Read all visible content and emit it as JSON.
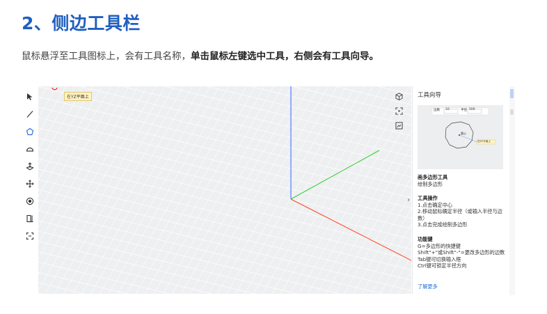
{
  "heading": "2、侧边工具栏",
  "description": {
    "normal": "鼠标悬浮至工具图标上，会有工具名称，",
    "bold": "单击鼠标左键选中工具，右侧会有工具向导。"
  },
  "viewport": {
    "tooltip": "在YZ平面上"
  },
  "toolbar": {
    "items": [
      {
        "icon": "select-arrow-icon"
      },
      {
        "icon": "line-icon"
      },
      {
        "icon": "polygon-icon"
      },
      {
        "icon": "arc-icon"
      },
      {
        "icon": "push-pull-icon"
      },
      {
        "icon": "move-icon"
      },
      {
        "icon": "material-icon"
      },
      {
        "icon": "section-icon"
      },
      {
        "icon": "dimension-icon"
      }
    ]
  },
  "view_tools": [
    {
      "icon": "cube-view-icon"
    },
    {
      "icon": "fit-view-icon"
    },
    {
      "icon": "screenshot-icon"
    }
  ],
  "panel": {
    "title": "工具向导",
    "preview": {
      "field1_label": "边数",
      "field1_value": "10",
      "field2_label": "半径",
      "field2_value": "500",
      "center_label": "圆心",
      "plane_label": "在XY平面上"
    },
    "tool_name": "画多边形工具",
    "tool_desc": "绘制多边形",
    "operation_title": "工具操作",
    "operations": [
      "1.点击确定中心",
      "2.移动鼠标确定半径（或输入半径与边数）",
      "3.点击完成绘制多边形"
    ],
    "keys_title": "功能键",
    "keys": [
      "G=多边形的快捷键",
      "Shift\"+\"或Shift\"-\"=更改多边形的边数",
      "Tab键可切换输入框",
      "Ctrl键可锁定半径方向"
    ],
    "more_link": "了解更多"
  },
  "colors": {
    "heading": "#1f5fbf",
    "link": "#1e6fd6",
    "axis_z": "#3366ff",
    "axis_y": "#33cc33",
    "axis_x": "#ff4422"
  }
}
